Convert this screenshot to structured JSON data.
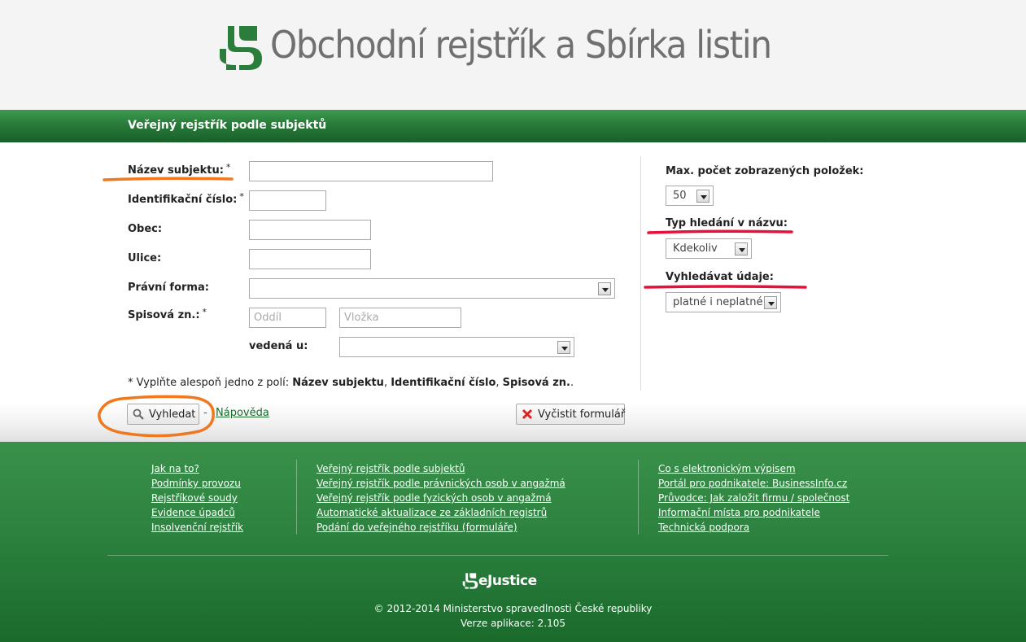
{
  "header": {
    "site_title": "Obchodní rejstřík a Sbírka listin"
  },
  "titlebar": {
    "title": "Veřejný rejstřík podle subjektů"
  },
  "form": {
    "nazev_label": "Název subjektu:",
    "ico_label": "Identifikační číslo:",
    "obec_label": "Obec:",
    "ulice_label": "Ulice:",
    "pravni_forma_label": "Právní forma:",
    "spisova_label": "Spisová zn.:",
    "oddil_placeholder": "Oddíl",
    "vlozka_placeholder": "Vložka",
    "vedena_label": "vedená u:",
    "required_mark": "*",
    "pravni_forma_value": "",
    "vedena_value": ""
  },
  "options": {
    "max_label": "Max. počet zobrazených položek:",
    "max_value": "50",
    "typ_label": "Typ hledání v názvu:",
    "typ_value": "Kdekoliv",
    "vyhledavat_label": "Vyhledávat údaje:",
    "vyhledavat_value": "platné i neplatné"
  },
  "note": {
    "prefix": "* Vyplňte alespoň jedno z polí: ",
    "f1": "Název subjektu",
    "sep1": ", ",
    "f2": "Identifikační číslo",
    "sep2": ", ",
    "f3": "Spisová zn.",
    "suffix": "."
  },
  "buttons": {
    "search_label": "Vyhledat",
    "dash": "-",
    "help_link": "Nápověda",
    "clear_label": "Vyčistit formulář"
  },
  "footer": {
    "col1": [
      "Jak na to?",
      "Podmínky provozu",
      "Rejstříkové soudy",
      "Evidence úpadců",
      "Insolvenční rejstřík"
    ],
    "col2": [
      "Veřejný rejstřík podle subjektů",
      "Veřejný rejstřík podle právnických osob v angažmá",
      "Veřejný rejstřík podle fyzických osob v angažmá",
      "Automatické aktualizace ze základních registrů",
      "Podání do veřejného rejstříku (formuláře)"
    ],
    "col3": [
      "Co s elektronickým výpisem",
      "Portál pro podnikatele: BusinessInfo.cz",
      "Průvodce: Jak založit firmu / společnost",
      "Informační místa pro podnikatele",
      "Technická podpora"
    ],
    "brand": "eJustice",
    "copyright": "© 2012-2014 Ministerstvo spravedlnosti České republiky",
    "version": "Verze aplikace: 2.105"
  },
  "colors": {
    "brand_green": "#2b7d3c",
    "link_green": "#1c6b2e",
    "annotation_orange": "#f07820",
    "annotation_red": "#e8103a"
  }
}
